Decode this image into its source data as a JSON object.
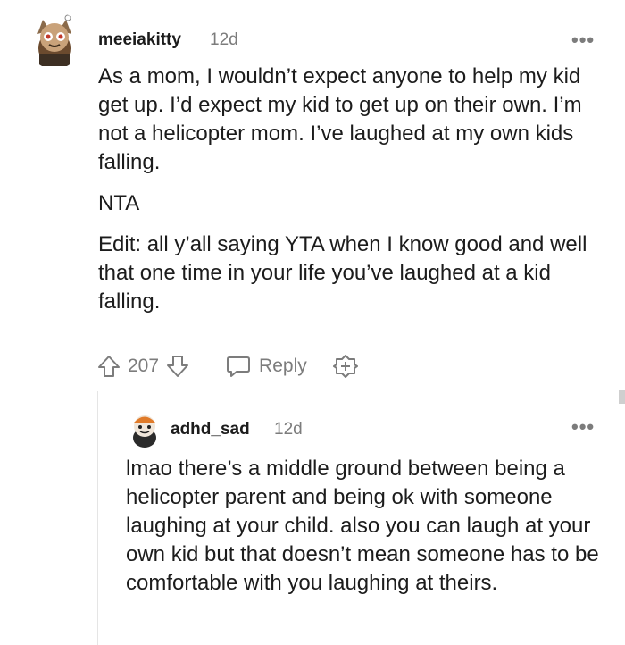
{
  "comments": [
    {
      "username": "meeiakitty",
      "age": "12d",
      "paragraphs": [
        "As a mom, I wouldn’t expect anyone to help my kid get up. I’d expect my kid to get up on their own. I’m not a helicopter mom. I’ve laughed at my own kids falling.",
        "NTA",
        "Edit: all y’all saying YTA when I know good and well that one time in your life you’ve laughed at a kid falling."
      ],
      "votes": "207",
      "reply_label": "Reply",
      "more_label": "•••"
    },
    {
      "username": "adhd_sad",
      "age": "12d",
      "paragraphs": [
        "lmao there’s a middle ground between being a helicopter parent and being ok with someone laughing at your child. also you can laugh at your own kid but that doesn’t mean someone has to be comfortable with you laughing at theirs."
      ],
      "more_label": "•••"
    }
  ],
  "colors": {
    "text": "#1c1c1c",
    "meta": "#7c7c7c",
    "thread_line": "#e5e5e5"
  },
  "icons": [
    "upvote-icon",
    "downvote-icon",
    "reply-bubble-icon",
    "award-plus-icon",
    "more-options-icon"
  ]
}
